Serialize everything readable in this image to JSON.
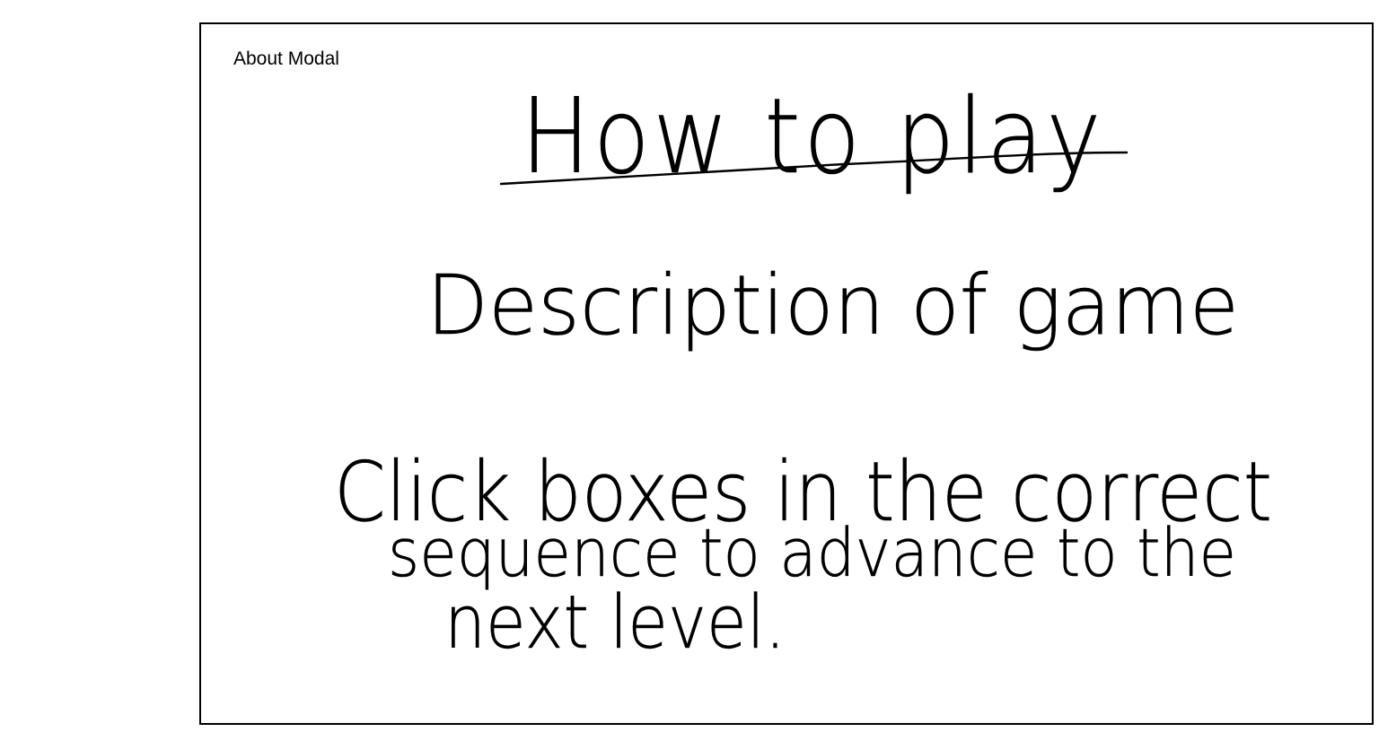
{
  "modal": {
    "label": "About Modal",
    "title": "How to play",
    "heading": "Description of game",
    "body_lines": [
      "Click boxes in the correct",
      "sequence to advance to the",
      "next level."
    ]
  }
}
